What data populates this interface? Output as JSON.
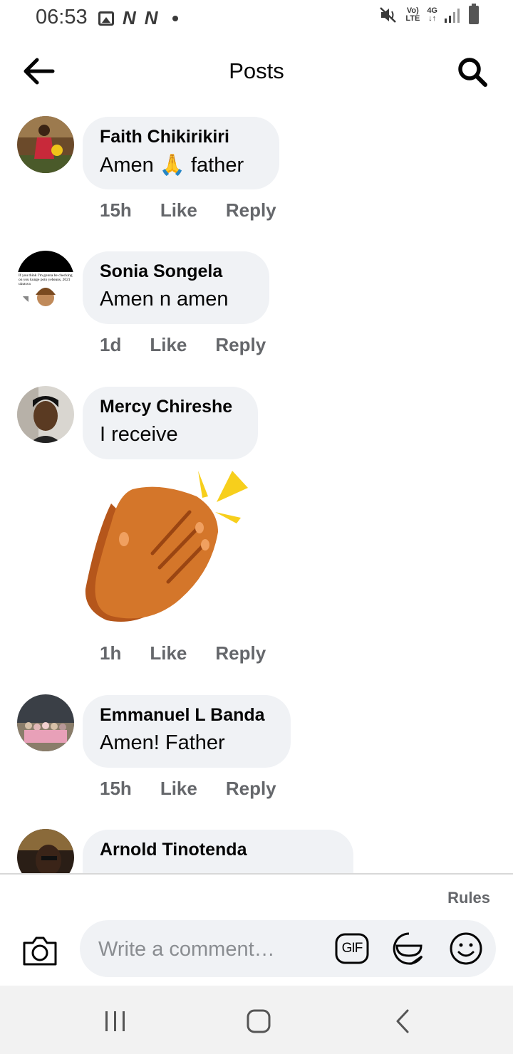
{
  "status_bar": {
    "time": "06:53",
    "notif_letters": [
      "N",
      "N"
    ],
    "network_top": "Vo)",
    "network_bottom": "LTE",
    "data_top": "4G",
    "data_bottom": "↓↑"
  },
  "header": {
    "title": "Posts",
    "back_icon": "arrow-left-icon",
    "search_icon": "search-icon"
  },
  "comments": [
    {
      "author": "Faith Chikirikiri",
      "text_before": "Amen",
      "emoji": "🙏",
      "text_after": "father",
      "time": "15h",
      "like": "Like",
      "reply": "Reply"
    },
    {
      "author": "Sonia Songela",
      "text": "Amen n amen",
      "time": "1d",
      "like": "Like",
      "reply": "Reply",
      "avatar_caption": "If you think I'm gonna be checking on you kunge poto yebeans, 2021 ukutsva"
    },
    {
      "author": "Mercy Chireshe",
      "text": "I receive",
      "time": "1h",
      "like": "Like",
      "reply": "Reply",
      "sticker": "clapping-hands-sticker"
    },
    {
      "author": "Emmanuel L Banda",
      "text": "Amen! Father",
      "time": "15h",
      "like": "Like",
      "reply": "Reply"
    },
    {
      "author": "Arnold Tinotenda"
    }
  ],
  "composer": {
    "rules_label": "Rules",
    "placeholder": "Write a comment…",
    "gif_label": "GIF",
    "icons": [
      "camera-icon",
      "gif-icon",
      "sticker-icon",
      "emoji-icon"
    ]
  },
  "colors": {
    "bubble": "#f0f2f5",
    "secondary_text": "#65676b",
    "primary_text": "#050505"
  }
}
